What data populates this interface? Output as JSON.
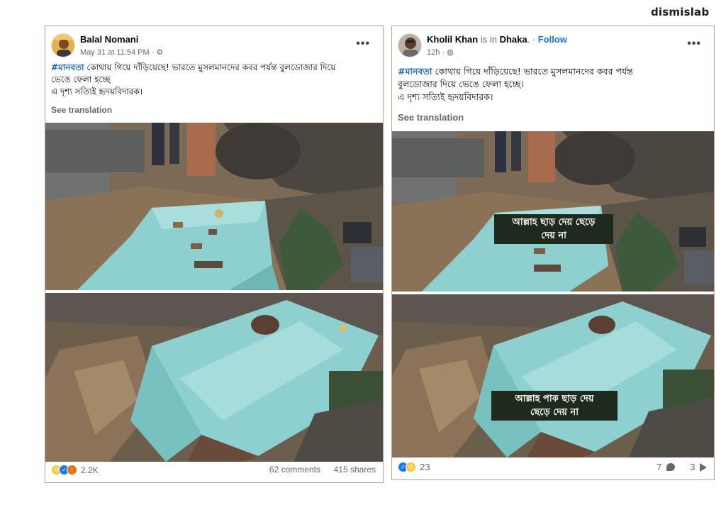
{
  "brand": "dismislab",
  "posts": [
    {
      "author": "Balal Nomani",
      "timestamp": "May 31 at 11:54 PM",
      "menu": "•••",
      "hashtag": "#মানবতা",
      "text_line1": " কোথায় গিয়ে দাঁড়িয়েছে! ভারতে মুসলমানদের কবর পর্যন্ত বুলডোজার দিয়ে",
      "text_line2": "ভেঙে ফেলা হচ্ছে",
      "text_line3": "এ দৃশ্য সত্যিই হৃদয়বিদারক।",
      "see_translation": "See translation",
      "reaction_count": "2.2K",
      "comments": "62 comments",
      "shares": "415 shares"
    },
    {
      "author": "Kholil Khan",
      "is_in": " is in ",
      "place": "Dhaka",
      "follow_sep": ". · ",
      "follow": "Follow",
      "timestamp": "12h",
      "menu": "•••",
      "hashtag": "#মানবতা",
      "text_line1": " কোথায় গিয়ে দাঁড়িয়েছে! ভারতে মুসলমানদের কবর পর্যন্ত",
      "text_line2": "বুলডোজার দিয়ে ভেঙে ফেলা হচ্ছে।",
      "text_line3": "এ দৃশ্য সত্যিই হৃদয়বিদারক।",
      "see_translation": "See translation",
      "caption_top_1": "আল্লাহ ছাড় দেয় ছেড়ে",
      "caption_top_2": "দেয় না",
      "caption_bottom_1": "আল্লাহ পাক ছাড় দেয়",
      "caption_bottom_2": "ছেড়ে দেয় না",
      "reaction_count": "23",
      "comments": "7",
      "shares": "3"
    }
  ],
  "icons": {
    "globe": "globe-icon",
    "settings": "gear-icon",
    "comment": "comment-icon",
    "share": "share-icon"
  },
  "colors": {
    "hashtag": "#1b64d6",
    "follow": "#1877f2",
    "muted": "#65676b",
    "post_border": "#c99a8e",
    "caption_bg": "#1e2a1c",
    "tomb": "#8fd3cf"
  }
}
